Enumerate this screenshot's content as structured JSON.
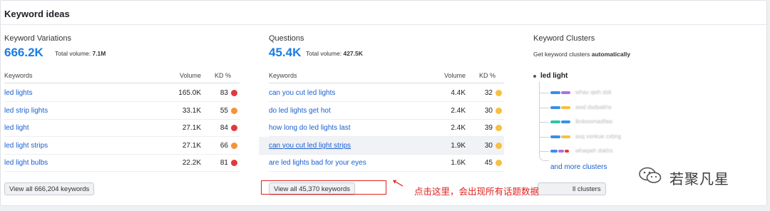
{
  "card": {
    "title": "Keyword ideas"
  },
  "variations": {
    "heading": "Keyword Variations",
    "count": "666.2K",
    "total_label": "Total volume:",
    "total_value": "7.1M",
    "columns": {
      "keyword": "Keywords",
      "volume": "Volume",
      "kd": "KD %"
    },
    "rows": [
      {
        "keyword": "led lights",
        "volume": "165.0K",
        "kd": "83",
        "kd_color": "#e0393e"
      },
      {
        "keyword": "led strip lights",
        "volume": "33.1K",
        "kd": "55",
        "kd_color": "#f59338"
      },
      {
        "keyword": "led light",
        "volume": "27.1K",
        "kd": "84",
        "kd_color": "#e0393e"
      },
      {
        "keyword": "led light strips",
        "volume": "27.1K",
        "kd": "66",
        "kd_color": "#f59338"
      },
      {
        "keyword": "led light bulbs",
        "volume": "22.2K",
        "kd": "81",
        "kd_color": "#e0393e"
      }
    ],
    "button": "View all 666,204 keywords"
  },
  "questions": {
    "heading": "Questions",
    "count": "45.4K",
    "total_label": "Total volume:",
    "total_value": "427.5K",
    "columns": {
      "keyword": "Keywords",
      "volume": "Volume",
      "kd": "KD %"
    },
    "rows": [
      {
        "keyword": "can you cut led lights",
        "volume": "4.4K",
        "kd": "32",
        "kd_color": "#f6c042"
      },
      {
        "keyword": "do led lights get hot",
        "volume": "2.4K",
        "kd": "30",
        "kd_color": "#f6c042"
      },
      {
        "keyword": "how long do led lights last",
        "volume": "2.4K",
        "kd": "39",
        "kd_color": "#f6c042"
      },
      {
        "keyword": "can you cut led light strips",
        "volume": "1.9K",
        "kd": "30",
        "kd_color": "#f6c042"
      },
      {
        "keyword": "are led lights bad for your eyes",
        "volume": "1.6K",
        "kd": "45",
        "kd_color": "#f6c042"
      }
    ],
    "button": "View all 45,370 keywords"
  },
  "clusters": {
    "heading": "Keyword Clusters",
    "subtitle_prefix": "Get keyword clusters",
    "subtitle_bold": "automatically",
    "root": "led light",
    "items": [
      {
        "label": "whau qwh dsk",
        "colors": [
          "#3a8fe8",
          "#b06ee8"
        ]
      },
      {
        "label": "awd dsdsakhs",
        "colors": [
          "#3a8fe8",
          "#f6c042"
        ]
      },
      {
        "label": "lknkwsmadfaw",
        "colors": [
          "#2ec4a5",
          "#3a8fe8"
        ]
      },
      {
        "label": "asq xsnkue cxbng",
        "colors": [
          "#3a8fe8",
          "#f6c042"
        ]
      },
      {
        "label": "whaqwh dskhs",
        "colors": [
          "#3a8fe8",
          "#b06ee8",
          "#e0393e"
        ]
      }
    ],
    "more_link": "and more clusters",
    "button_visible_text": "ll clusters"
  },
  "annotation": {
    "text": "点击这里，会出现所有话题数据"
  },
  "watermark": {
    "text": "若聚凡星",
    "icon": "wechat-icon"
  }
}
